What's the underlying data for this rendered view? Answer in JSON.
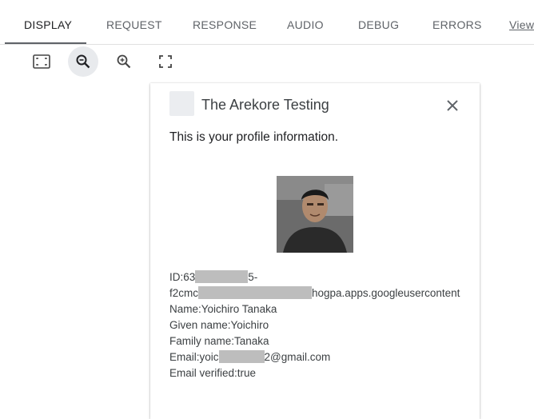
{
  "tabs": [
    {
      "label": "DISPLAY"
    },
    {
      "label": "REQUEST"
    },
    {
      "label": "RESPONSE"
    },
    {
      "label": "AUDIO"
    },
    {
      "label": "DEBUG"
    },
    {
      "label": "ERRORS"
    },
    {
      "label": "View"
    }
  ],
  "toolbar": {
    "icons": [
      "fit-screen-icon",
      "zoom-out-icon",
      "zoom-in-icon",
      "fullscreen-icon"
    ]
  },
  "card": {
    "title": "The Arekore Testing",
    "subtitle": "This is your profile information.",
    "profile": {
      "id_prefix": "ID:63",
      "id_after_redact": "5-",
      "id_line2_prefix": "f2cmc",
      "id_line2_suffix": "hogpa.apps.googleusercontent",
      "name": "Name:Yoichiro Tanaka",
      "given_name": "Given name:Yoichiro",
      "family_name": "Family name:Tanaka",
      "email_prefix": "Email:yoic",
      "email_suffix": "2@gmail.com",
      "email_verified": "Email verified:true"
    }
  },
  "colors": {
    "active_tab_underline": "#5f6368",
    "redaction": "#bdbdbd"
  }
}
